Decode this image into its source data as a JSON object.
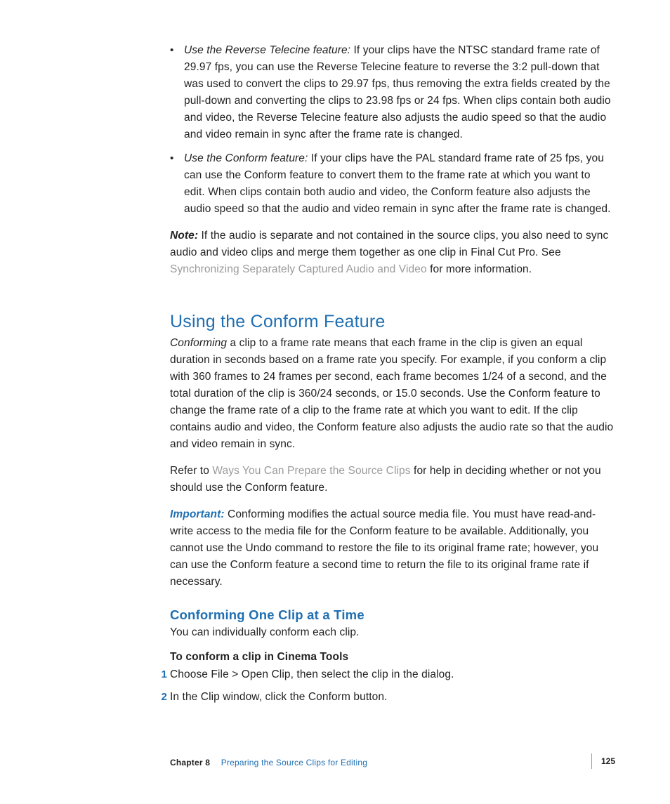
{
  "bullets": [
    {
      "lead": "Use the Reverse Telecine feature:",
      "text": "  If your clips have the NTSC standard frame rate of 29.97 fps, you can use the Reverse Telecine feature to reverse the 3:2 pull-down that was used to convert the clips to 29.97 fps, thus removing the extra fields created by the pull-down and converting the clips to 23.98 fps or 24 fps. When clips contain both audio and video, the Reverse Telecine feature also adjusts the audio speed so that the audio and video remain in sync after the frame rate is changed."
    },
    {
      "lead": "Use the Conform feature:",
      "text": "  If your clips have the PAL standard frame rate of 25 fps, you can use the Conform feature to convert them to the frame rate at which you want to edit. When clips contain both audio and video, the Conform feature also adjusts the audio speed so that the audio and video remain in sync after the frame rate is changed."
    }
  ],
  "note": {
    "label": "Note:",
    "text_before_link": "  If the audio is separate and not contained in the source clips, you also need to sync audio and video clips and merge them together as one clip in Final Cut Pro. See ",
    "link": "Synchronizing Separately Captured Audio and Video",
    "text_after_link": " for more information."
  },
  "section": {
    "heading": "Using the Conform Feature",
    "intro_lead_italic": "Conforming",
    "intro_rest": " a clip to a frame rate means that each frame in the clip is given an equal duration in seconds based on a frame rate you specify. For example, if you conform a clip with 360 frames to 24 frames per second, each frame becomes 1/24 of a second, and the total duration of the clip is 360/24 seconds, or 15.0 seconds. Use the Conform feature to change the frame rate of a clip to the frame rate at which you want to edit. If the clip contains audio and video, the Conform feature also adjusts the audio rate so that the audio and video remain in sync.",
    "refer_before": "Refer to ",
    "refer_link": "Ways You Can Prepare the Source Clips",
    "refer_after": " for help in deciding whether or not you should use the Conform feature.",
    "important_label": "Important:",
    "important_text": "  Conforming modifies the actual source media file. You must have read-and-write access to the media file for the Conform feature to be available. Additionally, you cannot use the Undo command to restore the file to its original frame rate; however, you can use the Conform feature a second time to return the file to its original frame rate if necessary."
  },
  "subsection": {
    "heading": "Conforming One Clip at a Time",
    "intro": "You can individually conform each clip.",
    "task_heading": "To conform a clip in Cinema Tools",
    "steps": [
      {
        "num": "1",
        "text": "Choose File > Open Clip, then select the clip in the dialog."
      },
      {
        "num": "2",
        "text": "In the Clip window, click the Conform button."
      }
    ]
  },
  "footer": {
    "chapter_label": "Chapter 8",
    "chapter_title": "Preparing the Source Clips for Editing",
    "page_num": "125"
  }
}
